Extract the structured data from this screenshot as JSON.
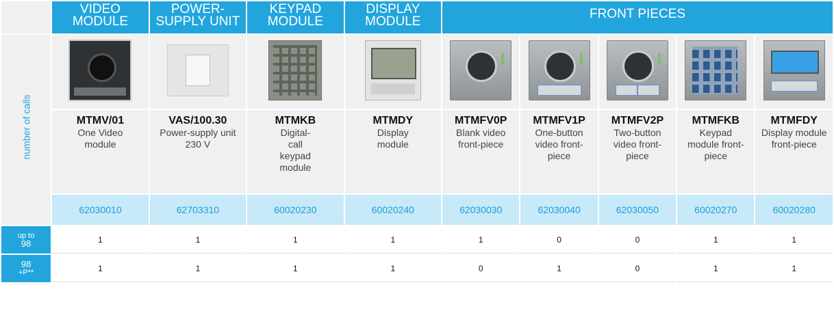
{
  "headers": {
    "video_module": "VIDEO MODULE",
    "psu": "POWER- SUPPLY UNIT",
    "keypad": "KEYPAD MODULE",
    "display": "DISPLAY MODULE",
    "front_pieces": "FRONT PIECES"
  },
  "side_label": "number of calls",
  "products": [
    {
      "code": "MTMV/01",
      "desc": "One Video module",
      "order": "62030010"
    },
    {
      "code": "VAS/100.30",
      "desc": "Power-supply unit 230 V",
      "order": "62703310"
    },
    {
      "code": "MTMKB",
      "desc": "Digital-call keypad module",
      "order": "60020230"
    },
    {
      "code": "MTMDY",
      "desc": "Display module",
      "order": "60020240"
    },
    {
      "code": "MTMFV0P",
      "desc": "Blank video front-piece",
      "order": "62030030"
    },
    {
      "code": "MTMFV1P",
      "desc": "One-button video front-piece",
      "order": "62030040"
    },
    {
      "code": "MTMFV2P",
      "desc": "Two-button video front-piece",
      "order": "62030050"
    },
    {
      "code": "MTMFKB",
      "desc": "Keypad module front-piece",
      "order": "60020270"
    },
    {
      "code": "MTMFDY",
      "desc": "Display module front-piece",
      "order": "60020280"
    }
  ],
  "rows": [
    {
      "label_small": "up to",
      "label_big": "98",
      "values": [
        "1",
        "1",
        "1",
        "1",
        "1",
        "0",
        "0",
        "1",
        "1"
      ]
    },
    {
      "label_small": "98",
      "label_big": "+P**",
      "values": [
        "1",
        "1",
        "1",
        "1",
        "0",
        "1",
        "0",
        "1",
        "1"
      ]
    }
  ],
  "colors": {
    "accent": "#22a5dd",
    "light_blue": "#c7e9f9",
    "grey": "#f0f0f0"
  }
}
